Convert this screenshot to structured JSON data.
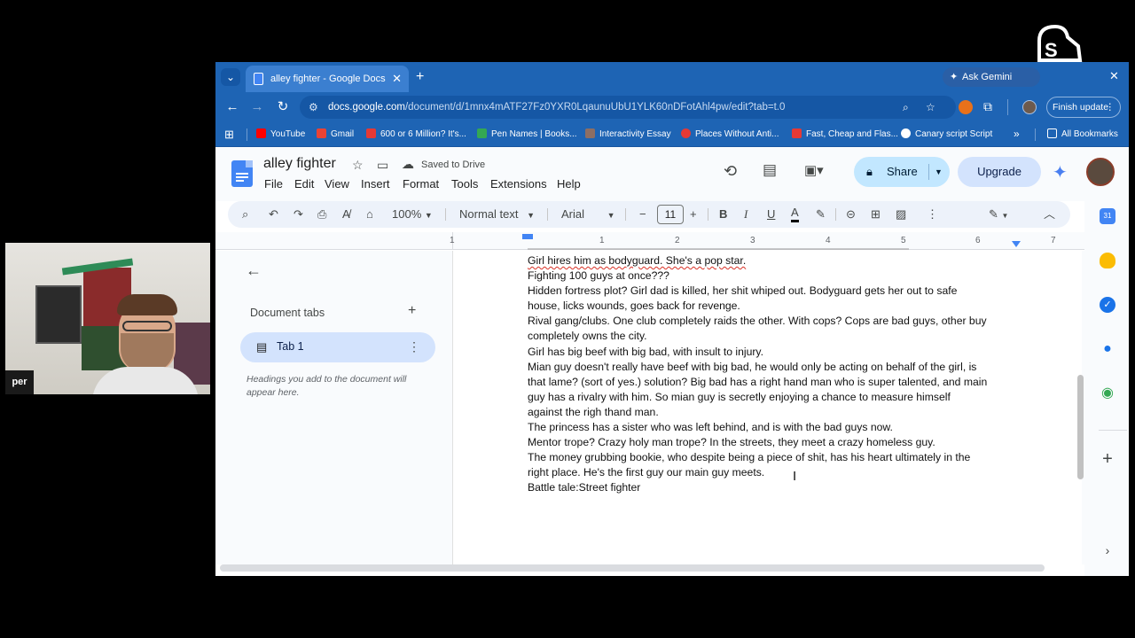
{
  "browser": {
    "tab_title": "alley fighter - Google Docs",
    "ask_gemini": "Ask Gemini",
    "url_host": "docs.google.com",
    "url_path": "/document/d/1mnx4mATF27Fz0YXR0LqaunuUbU1YLK60nDFotAhl4pw/edit?tab=t.0",
    "finish_update": "Finish update",
    "bookmarks": [
      {
        "label": "YouTube",
        "color": "#ff0000"
      },
      {
        "label": "Gmail",
        "color": "#ea4335"
      },
      {
        "label": "600 or 6 Million? It's...",
        "color": "#e53935"
      },
      {
        "label": "Pen Names | Books...",
        "color": "#34a853"
      },
      {
        "label": "Interactivity Essay",
        "color": "#8d6e63"
      },
      {
        "label": "Places Without Anti...",
        "color": "#e53935"
      },
      {
        "label": "Fast, Cheap and Flas...",
        "color": "#e53935"
      },
      {
        "label": "Canary script Script",
        "color": "#ffffff"
      }
    ],
    "all_bookmarks": "All Bookmarks"
  },
  "docs": {
    "title": "alley fighter",
    "saved": "Saved to Drive",
    "menus": [
      "File",
      "Edit",
      "View",
      "Insert",
      "Format",
      "Tools",
      "Extensions",
      "Help"
    ],
    "share": "Share",
    "upgrade": "Upgrade",
    "zoom": "100%",
    "style": "Normal text",
    "font": "Arial",
    "font_size": "11",
    "ruler_numbers": [
      "1",
      "1",
      "2",
      "3",
      "4",
      "5",
      "6",
      "7"
    ]
  },
  "tabs_panel": {
    "heading": "Document tabs",
    "tab1": "Tab 1",
    "hint": "Headings you add to the document will appear here."
  },
  "document": {
    "lines": [
      "Girl hires him as bodyguard. She's a pop star.",
      "Fighting 100 guys at once???",
      "Hidden fortress plot? Girl dad is killed, her shit whiped out. Bodyguard gets her out to safe",
      "house, licks wounds, goes back for revenge.",
      "Rival gang/clubs. One club completely raids the other. With cops? Cops are bad guys, other buy",
      "completely owns the city.",
      "Girl has big beef with big bad, with insult to injury.",
      "Mian guy doesn't really have beef with big bad, he would only be acting on behalf of the girl, is",
      "that lame? (sort of yes.) solution? Big bad has a right hand man who is super talented, and main",
      "guy has a rivalry with him. So mian guy is secretly enjoying a chance to measure himself",
      "against the righ thand man.",
      "The princess has a sister who was left behind, and is with the bad guys now.",
      "Mentor trope? Crazy holy man trope? In the streets, they meet a crazy homeless guy.",
      "The money grubbing bookie, who despite being a piece of shit, has his heart ultimately in the",
      "right place. He's the first guy our main guy meets.",
      "Battle tale:Street fighter"
    ]
  },
  "webcam": {
    "label": "per"
  },
  "overlay": {
    "brand": "streamyard"
  }
}
